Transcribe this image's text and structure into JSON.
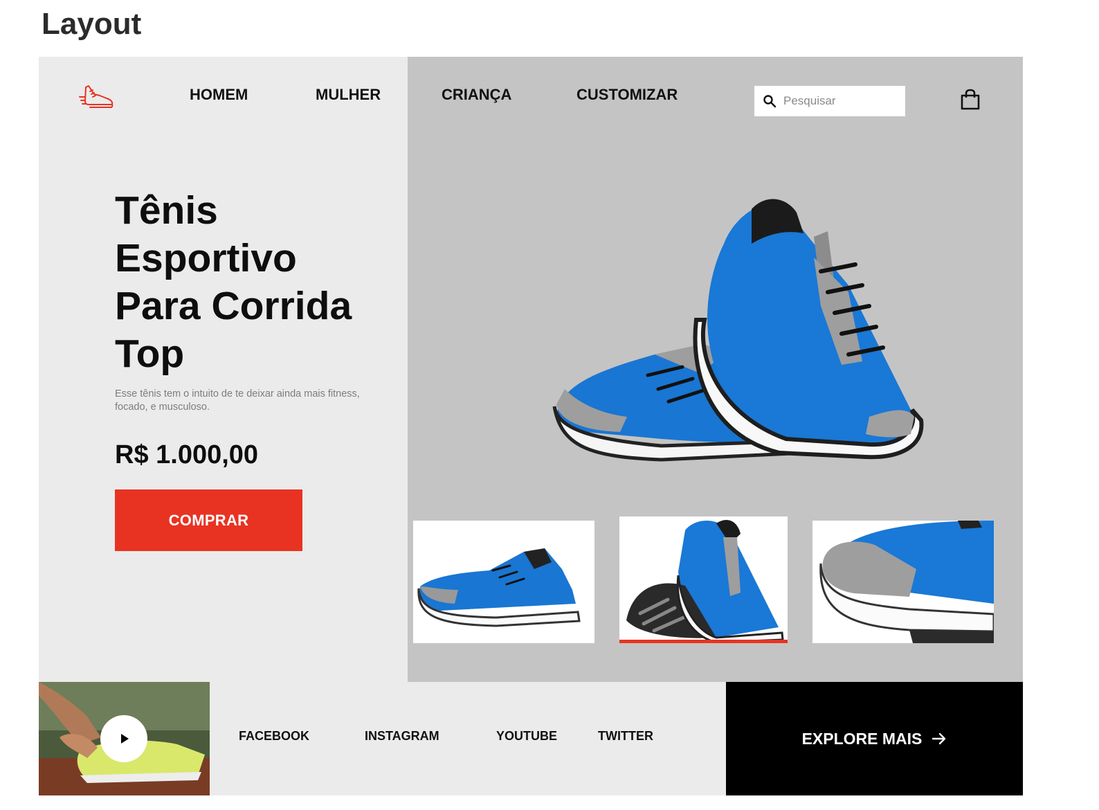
{
  "page": {
    "heading": "Layout"
  },
  "brand": {
    "accent_color": "#e83323",
    "logo_icon": "running-shoe-icon"
  },
  "nav": {
    "items": [
      {
        "label": "HOMEM"
      },
      {
        "label": "MULHER"
      },
      {
        "label": "CRIANÇA"
      },
      {
        "label": "CUSTOMIZAR"
      }
    ]
  },
  "search": {
    "placeholder": "Pesquisar",
    "value": "",
    "icon": "search-icon"
  },
  "cart": {
    "icon": "shopping-bag-icon"
  },
  "hero": {
    "title": "Tênis Esportivo Para Corrida Top",
    "description": "Esse tênis tem o intuito de te deixar ainda mais fitness, focado, e musculoso.",
    "price": "R$ 1.000,00",
    "buy_label": "COMPRAR"
  },
  "gallery": {
    "main_image": "blue-running-shoes-pair",
    "thumbnails": [
      {
        "image": "shoes-side-view",
        "active": false
      },
      {
        "image": "shoes-sole-view",
        "active": true
      },
      {
        "image": "shoe-closeup-view",
        "active": false
      }
    ]
  },
  "footer": {
    "video": {
      "image": "tying-shoelace",
      "play_icon": "play-icon"
    },
    "social": [
      {
        "label": "FACEBOOK"
      },
      {
        "label": "INSTAGRAM"
      },
      {
        "label": "YOUTUBE"
      },
      {
        "label": "TWITTER"
      }
    ],
    "explore_label": "EXPLORE MAIS",
    "explore_icon": "arrow-right-icon"
  }
}
